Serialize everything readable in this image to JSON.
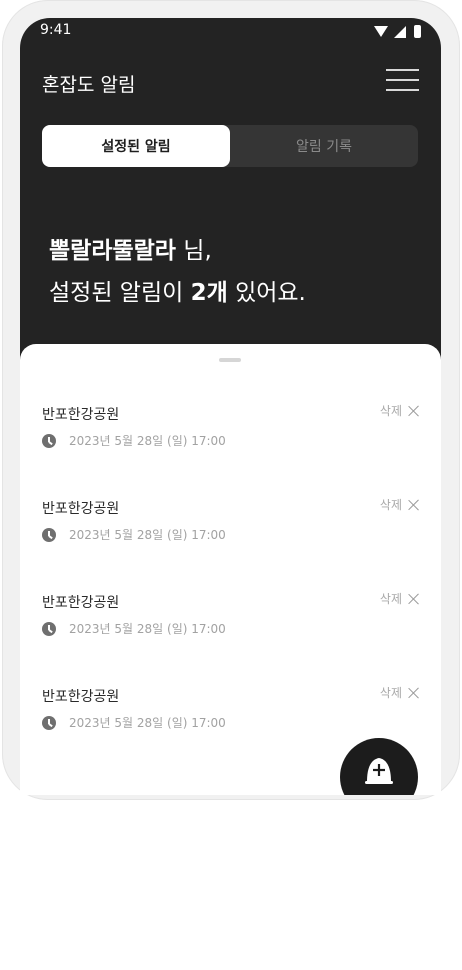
{
  "status_bar": {
    "time": "9:41"
  },
  "header": {
    "title": "혼잡도 알림"
  },
  "tabs": [
    {
      "label": "설정된 알림",
      "active": true
    },
    {
      "label": "알림 기록",
      "active": false
    }
  ],
  "greeting": {
    "user_name": "뽈랄라뚤랄라",
    "suffix": " 님,",
    "line2_prefix": "설정된 알림이 ",
    "count": "2개",
    "line2_suffix": " 있어요."
  },
  "alarms": [
    {
      "place": "반포한강공원",
      "datetime": "2023년 5월 28일 (일) 17:00",
      "delete_label": "삭제"
    },
    {
      "place": "반포한강공원",
      "datetime": "2023년 5월 28일 (일) 17:00",
      "delete_label": "삭제"
    },
    {
      "place": "반포한강공원",
      "datetime": "2023년 5월 28일 (일) 17:00",
      "delete_label": "삭제"
    },
    {
      "place": "반포한강공원",
      "datetime": "2023년 5월 28일 (일) 17:00",
      "delete_label": "삭제"
    }
  ],
  "icons": {
    "menu": "hamburger-menu-icon",
    "clock": "clock-icon",
    "delete": "close-icon",
    "fab": "bell-add-icon"
  },
  "colors": {
    "dark_bg": "#232323",
    "tab_bg": "#353535",
    "fab": "#1c1c1c"
  }
}
